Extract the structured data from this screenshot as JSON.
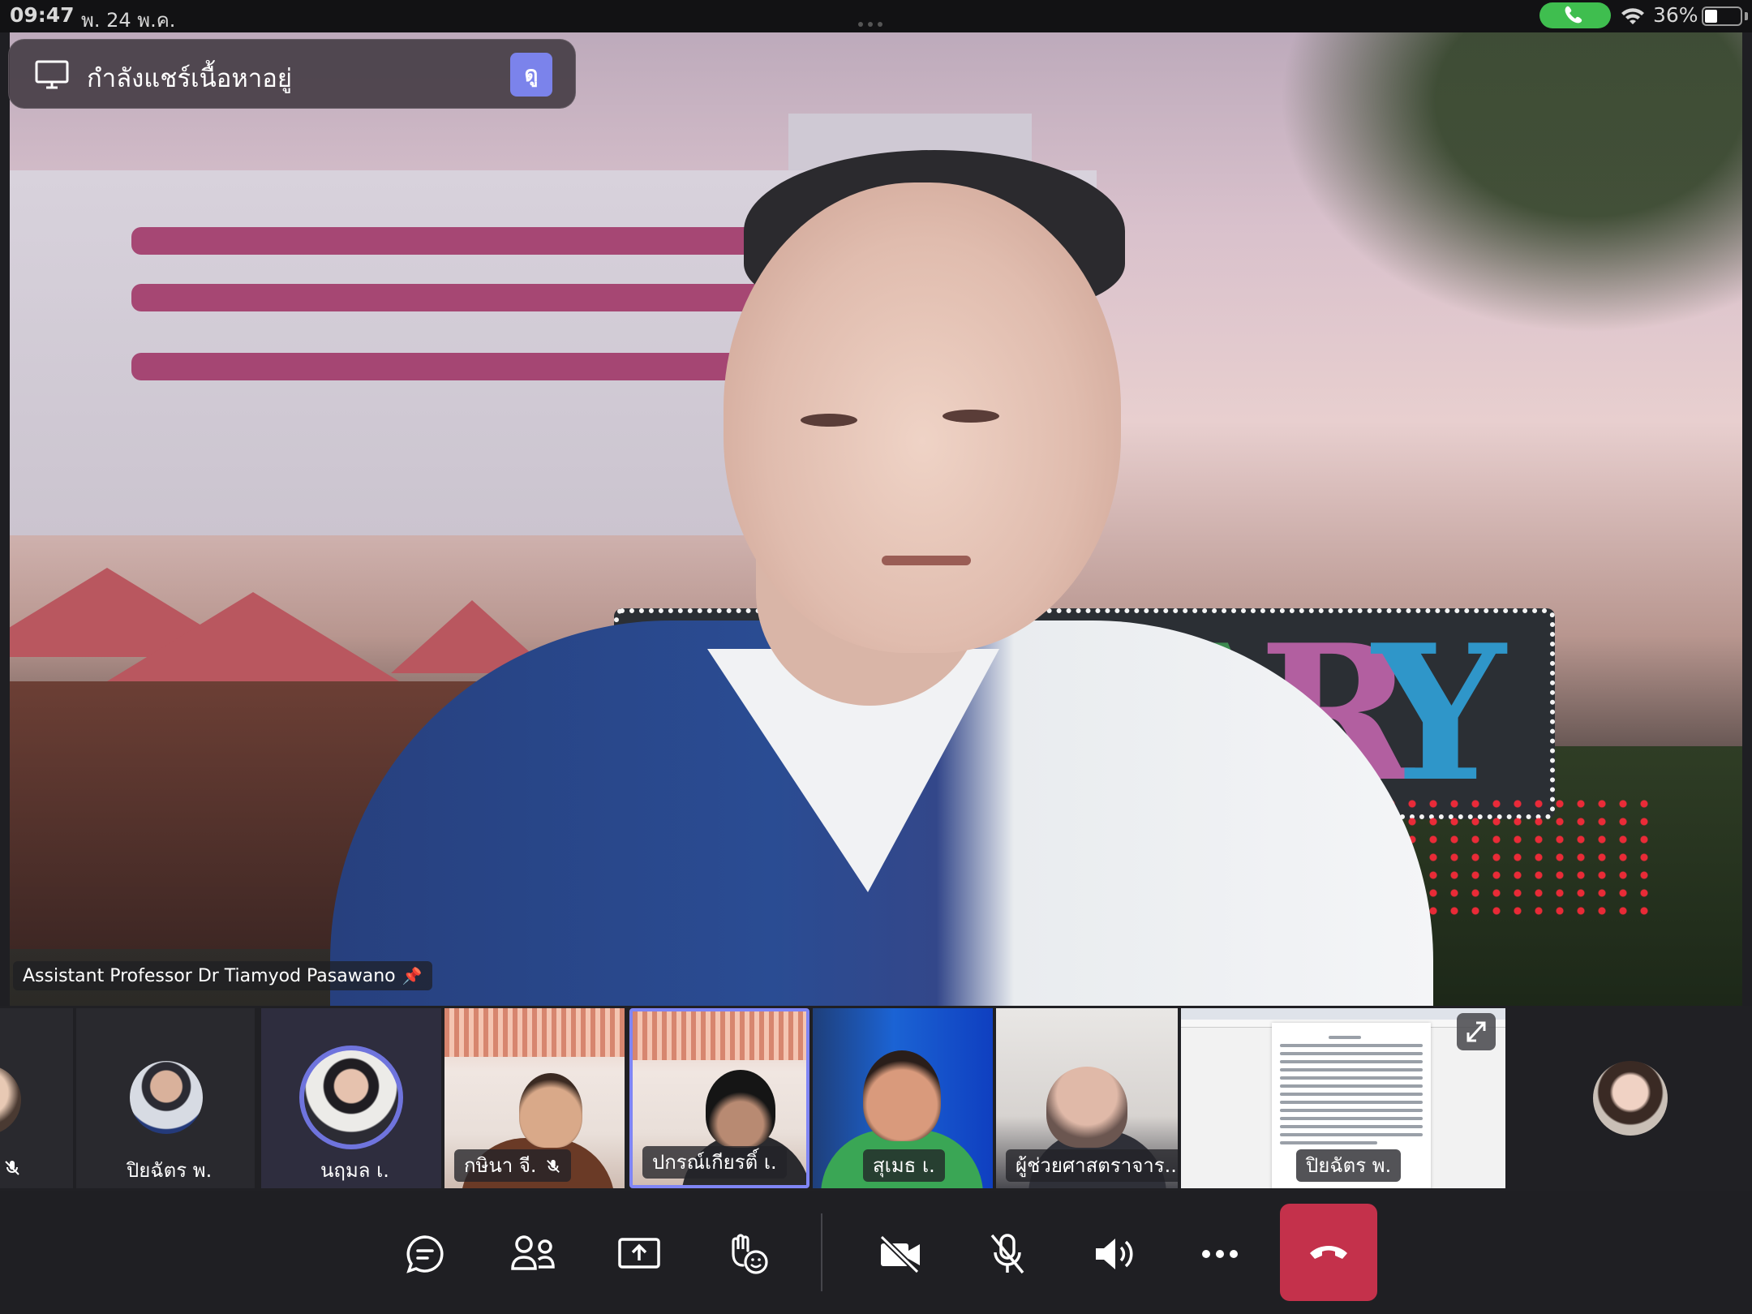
{
  "status_bar": {
    "time": "09:47",
    "date": "พ. 24 พ.ค.",
    "battery_percent": "36%",
    "battery_level": 0.36,
    "call_active_color": "#3fbe4f",
    "icons": [
      "phone-icon",
      "wifi-icon",
      "battery-icon"
    ]
  },
  "sharing_banner": {
    "label": "กำลังแชร์เนื้อหาอยู่",
    "view_button": "ดู",
    "icon": "monitor-icon",
    "button_color": "#7b83eb"
  },
  "main_video": {
    "speaker_name": "Assistant Professor Dr Tiamyod Pasawano",
    "pinned": true,
    "pin_icon": "pin-icon"
  },
  "participants": [
    {
      "name": "",
      "muted": true,
      "type": "avatar"
    },
    {
      "name": "ปิยฉัตร พ.",
      "muted": false,
      "type": "avatar"
    },
    {
      "name": "นฤมล เ.",
      "muted": false,
      "type": "avatar-self",
      "ring_color": "#6f74dd"
    },
    {
      "name": "กษินา จี.",
      "muted": true,
      "type": "video"
    },
    {
      "name": "ปกรณ์เกียรติ์ เ.",
      "muted": false,
      "type": "video",
      "speaking": true
    },
    {
      "name": "สุเมธ เ.",
      "muted": false,
      "type": "video"
    },
    {
      "name": "ผู้ช่วยศาสตราจาร...",
      "muted": false,
      "type": "video"
    },
    {
      "name": "ปิยฉัตร พ.",
      "muted": false,
      "type": "screen-share"
    },
    {
      "name": "",
      "muted": false,
      "type": "avatar"
    }
  ],
  "controls": [
    {
      "name": "chat",
      "icon": "chat-icon"
    },
    {
      "name": "people",
      "icon": "people-icon"
    },
    {
      "name": "share",
      "icon": "share-screen-icon"
    },
    {
      "name": "reactions",
      "icon": "raise-hand-icon"
    },
    {
      "name": "camera",
      "icon": "camera-off-icon"
    },
    {
      "name": "microphone",
      "icon": "mic-off-icon"
    },
    {
      "name": "speaker",
      "icon": "speaker-icon"
    },
    {
      "name": "more",
      "icon": "more-icon"
    },
    {
      "name": "leave",
      "icon": "hang-up-icon",
      "color": "#c4314b"
    }
  ]
}
